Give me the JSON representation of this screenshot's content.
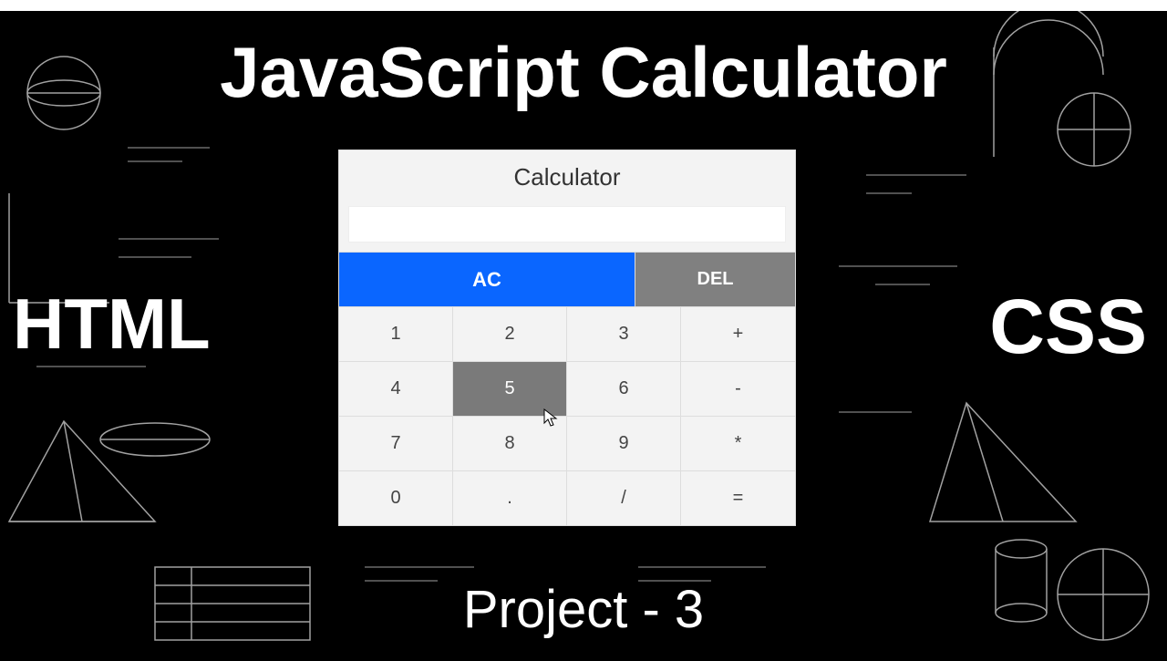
{
  "overlay": {
    "title": "JavaScript Calculator",
    "left": "HTML",
    "right": "CSS",
    "bottom": "Project - 3"
  },
  "calc": {
    "title": "Calculator",
    "display": "",
    "row_control": {
      "ac": "AC",
      "del": "DEL"
    },
    "rows": [
      [
        "1",
        "2",
        "3",
        "+"
      ],
      [
        "4",
        "5",
        "6",
        "-"
      ],
      [
        "7",
        "8",
        "9",
        "*"
      ],
      [
        "0",
        ".",
        "/",
        "="
      ]
    ],
    "hovered": "5"
  },
  "colors": {
    "accent": "#0a66ff",
    "grey": "#808080",
    "key_hover": "#7a7a7a"
  }
}
